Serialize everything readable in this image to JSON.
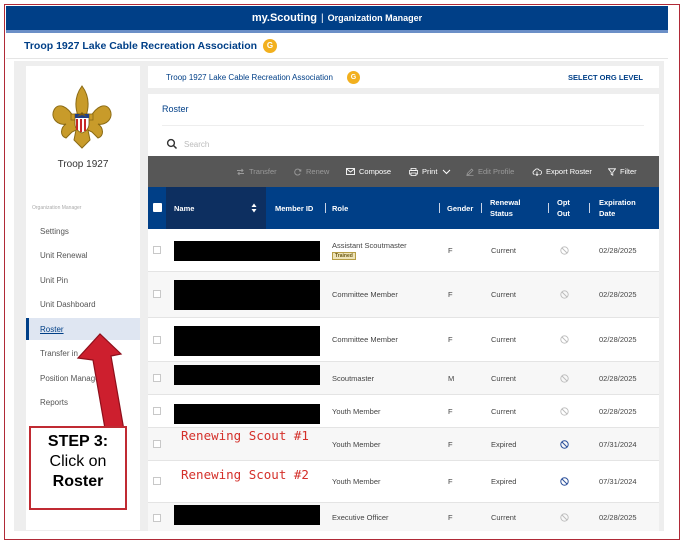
{
  "topbar": {
    "brand": "my.Scouting",
    "separator": "|",
    "subtitle": "Organization Manager"
  },
  "org_bar": {
    "title": "Troop 1927 Lake Cable Recreation Association",
    "badge": "G"
  },
  "sidebar": {
    "unit_name": "Troop 1927",
    "caption": "Organization Manager",
    "items": [
      {
        "label": "Settings"
      },
      {
        "label": "Unit Renewal"
      },
      {
        "label": "Unit Pin"
      },
      {
        "label": "Unit Dashboard"
      },
      {
        "label": "Roster"
      },
      {
        "label": "Transfer in"
      },
      {
        "label": "Position Manager"
      },
      {
        "label": "Reports"
      }
    ],
    "active_item": "Roster"
  },
  "main": {
    "org_title": "Troop 1927 Lake Cable Recreation Association",
    "org_badge": "G",
    "select_level": "SELECT ORG LEVEL",
    "roster_title": "Roster",
    "search_placeholder": "Search"
  },
  "toolbar": {
    "transfer": "Transfer",
    "renew": "Renew",
    "compose": "Compose",
    "print": "Print",
    "edit_profile": "Edit Profile",
    "export_roster": "Export Roster",
    "filter": "Filter"
  },
  "table": {
    "headers": {
      "name": "Name",
      "member_id": "Member ID",
      "role": "Role",
      "gender": "Gender",
      "renewal_status": "Renewal Status",
      "opt_out": "Opt Out",
      "expiration_date": "Expiration Date"
    },
    "rows": [
      {
        "role": "Assistant Scoutmaster",
        "badge": "Trained",
        "gender": "F",
        "status": "Current",
        "expiration": "02/28/2025"
      },
      {
        "role": "Committee Member",
        "gender": "F",
        "status": "Current",
        "expiration": "02/28/2025"
      },
      {
        "role": "Committee Member",
        "gender": "F",
        "status": "Current",
        "expiration": "02/28/2025"
      },
      {
        "role": "Scoutmaster",
        "gender": "M",
        "status": "Current",
        "expiration": "02/28/2025"
      },
      {
        "role": "Youth Member",
        "gender": "F",
        "status": "Current",
        "expiration": "02/28/2025"
      },
      {
        "role": "Youth Member",
        "gender": "F",
        "status": "Expired",
        "expiration": "07/31/2024",
        "name_note": "Renewing Scout #1"
      },
      {
        "role": "Youth Member",
        "gender": "F",
        "status": "Expired",
        "expiration": "07/31/2024",
        "name_note": "Renewing Scout #2"
      },
      {
        "role": "Executive Officer",
        "gender": "F",
        "status": "Current",
        "expiration": "02/28/2025"
      }
    ]
  },
  "callout": {
    "line1": "STEP 3:",
    "line2": "Click on",
    "line3": "Roster"
  },
  "colors": {
    "navy": "#003f87",
    "header_dark": "#0d2f60",
    "toolbar": "#575757",
    "gold": "#f2b01e",
    "callout_red": "#c02a32",
    "annotation_red": "#d4302a"
  }
}
